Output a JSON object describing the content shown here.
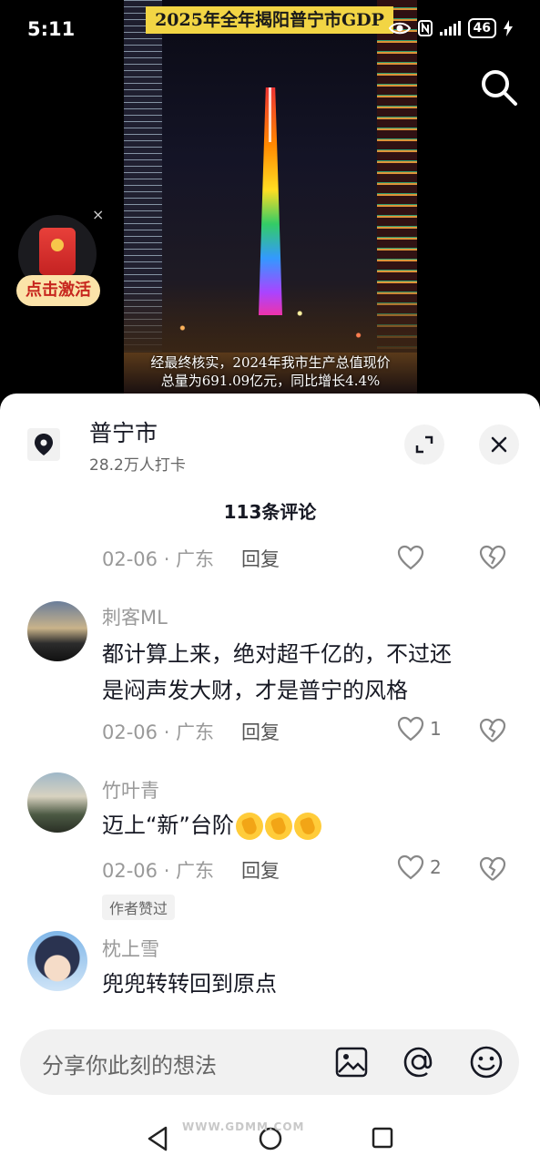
{
  "status_bar": {
    "time": "5:11",
    "battery": "46"
  },
  "video": {
    "title": "2025年全年揭阳普宁市GDP",
    "caption_line1": "经最终核实，2024年我市生产总值现价",
    "caption_line2": "总量为691.09亿元，同比增长4.4%"
  },
  "red_packet": {
    "label": "点击激活",
    "close": "×"
  },
  "location": {
    "name": "普宁市",
    "checkins": "28.2万人打卡"
  },
  "comments_header": "113条评论",
  "comments": [
    {
      "date": "02-06 · 广东",
      "reply": "回复",
      "likes": ""
    },
    {
      "user": "刺客ML",
      "text_line1": "都计算上来，绝对超千亿的，不过还",
      "text_line2": "是闷声发大财，才是普宁的风格",
      "date": "02-06 · 广东",
      "reply": "回复",
      "likes": "1"
    },
    {
      "user": "竹叶青",
      "text": "迈上“新”台阶",
      "date": "02-06 · 广东",
      "reply": "回复",
      "likes": "2",
      "badge": "作者赞过"
    },
    {
      "user": "枕上雪",
      "text": "兜兜转转回到原点"
    }
  ],
  "input": {
    "placeholder": "分享你此刻的想法"
  },
  "watermark": "WWW.GDMM.COM"
}
